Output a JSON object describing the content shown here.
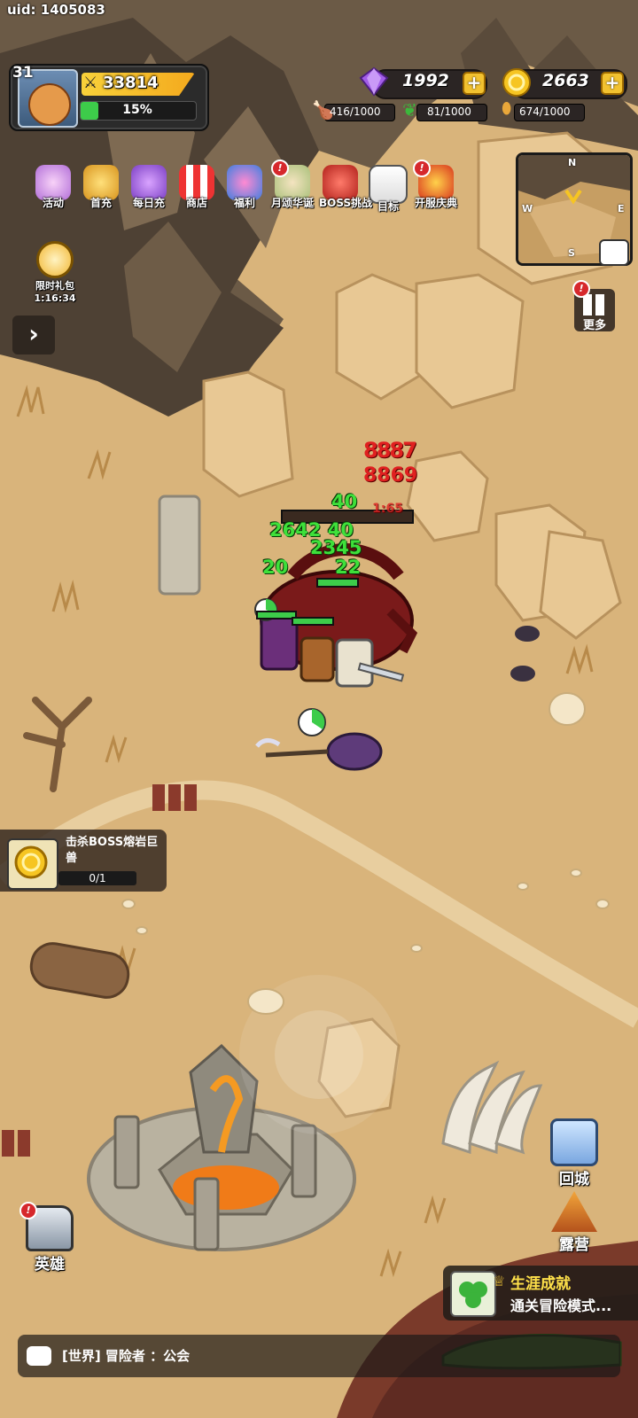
{
  "header": {
    "uid": "uid: 1405083"
  },
  "player": {
    "level": "31",
    "power": "33814",
    "exp_text": "15%",
    "exp_fraction": 0.15
  },
  "currency": {
    "gems": "1992",
    "gold": "2663",
    "plus": "+"
  },
  "resources": {
    "meat": "416/1000",
    "herb": "81/1000",
    "ore": "674/1000"
  },
  "top_menu": [
    "活动",
    "首充",
    "每日充",
    "商店",
    "福利",
    "月颂华诞",
    "BOSS挑战",
    "目标",
    "开服庆典"
  ],
  "badges": {
    "alert": "!"
  },
  "gift_pack": {
    "label": "限时礼包",
    "timer": "1:16:34"
  },
  "minimap": {
    "n": "N",
    "w": "W",
    "e": "E",
    "s": "S"
  },
  "side": {
    "more": "更多",
    "return_city": "回城",
    "camp": "露营",
    "heroes": "英雄"
  },
  "quest": {
    "title": "击杀BOSS熔岩巨兽",
    "progress": "0/1"
  },
  "achievement": {
    "title": "生涯成就",
    "desc": "通关冒险模式..."
  },
  "chat": {
    "message": "[世界] 冒险者 ：公会"
  },
  "battle": {
    "damage_red": [
      "8887",
      "8869",
      "1:65"
    ],
    "damage_green": [
      "40",
      "2642 40",
      "2345",
      "20",
      "22"
    ]
  },
  "colors": {
    "accent_gold": "#f6c522",
    "exp_green": "#3dcc4a",
    "gem_purple": "#a25de8",
    "badge_red": "#d6282c"
  }
}
